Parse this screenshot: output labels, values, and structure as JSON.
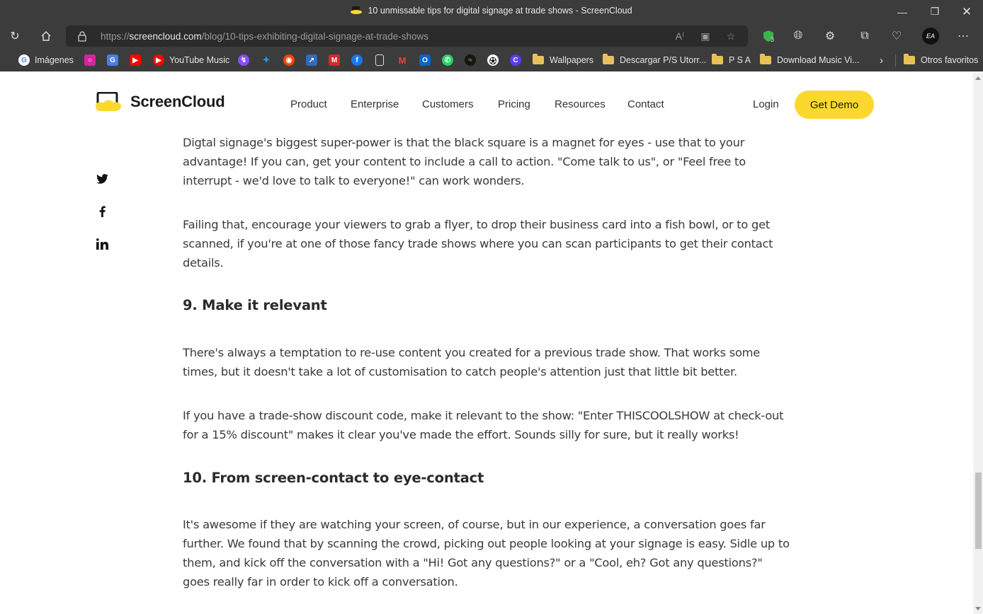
{
  "browser": {
    "window_title": "10 unmissable tips for digital signage at trade shows - ScreenCloud",
    "url_prefix": "https://",
    "url_host": "screencloud.com",
    "url_path": "/blog/10-tips-exhibiting-digital-signage-at-trade-shows",
    "extension_badge": "3",
    "profile_initials": "EA",
    "bookmarks": [
      {
        "label": "Imágenes",
        "icon": "google-icon"
      },
      {
        "label": "",
        "icon": "instagram-icon"
      },
      {
        "label": "",
        "icon": "google-translate-icon"
      },
      {
        "label": "",
        "icon": "youtube-icon"
      },
      {
        "label": "YouTube Music",
        "icon": "youtube-music-icon"
      },
      {
        "label": "",
        "icon": "messenger-icon"
      },
      {
        "label": "",
        "icon": "twitter-icon"
      },
      {
        "label": "",
        "icon": "reddit-icon"
      },
      {
        "label": "",
        "icon": "app-icon"
      },
      {
        "label": "",
        "icon": "mega-icon"
      },
      {
        "label": "",
        "icon": "facebook-icon"
      },
      {
        "label": "",
        "icon": "document-icon"
      },
      {
        "label": "",
        "icon": "gmail-icon"
      },
      {
        "label": "",
        "icon": "outlook-icon"
      },
      {
        "label": "",
        "icon": "whatsapp-icon"
      },
      {
        "label": "",
        "icon": "spotify-icon"
      },
      {
        "label": "",
        "icon": "soccer-ball-icon"
      },
      {
        "label": "",
        "icon": "app-icon"
      },
      {
        "label": "Wallpapers",
        "icon": "folder-icon"
      },
      {
        "label": "Descargar P/S Utorr...",
        "icon": "folder-icon"
      },
      {
        "label": "P S A",
        "icon": "folder-icon"
      },
      {
        "label": "Download Music Vi...",
        "icon": "folder-icon"
      }
    ],
    "other_favorites": "Otros favoritos"
  },
  "site": {
    "brand": "ScreenCloud",
    "nav": [
      "Product",
      "Enterprise",
      "Customers",
      "Pricing",
      "Resources",
      "Contact"
    ],
    "login": "Login",
    "cta": "Get Demo",
    "accent_color": "#fcd82e"
  },
  "article": {
    "p1": "Digtal signage's biggest super-power is that the black square is a magnet for eyes - use that to your advantage! If you can, get your content to include a call to action. \"Come talk to us\", or \"Feel free to interrupt - we'd love to talk to everyone!\" can work wonders.",
    "p2": "Failing that, encourage your viewers to grab a flyer, to drop their business card into a fish bowl, or to get scanned, if you're at one of those fancy trade shows where you can scan participants to get their contact details.",
    "h9": "9. Make it relevant",
    "p3": "There's always a temptation to re-use content you created for a previous trade show. That works some times, but it doesn't take a lot of customisation to catch people's attention just that little bit better.",
    "p4": "If you have a trade-show discount code, make it relevant to the show: \"Enter THISCOOLSHOW at check-out for a 15% discount\" makes it clear you've made the effort. Sounds silly for sure, but it really works!",
    "h10": "10. From screen-contact to eye-contact",
    "p5": "It's awesome if they are watching your screen, of course, but in our experience, a conversation goes far further. We found that by scanning the crowd, picking out people looking at your signage is easy. Sidle up to them, and kick off the conversation with a \"Hi! Got any questions?\" or a \"Cool, eh? Got any questions?\" goes really far in order to kick off a conversation."
  }
}
